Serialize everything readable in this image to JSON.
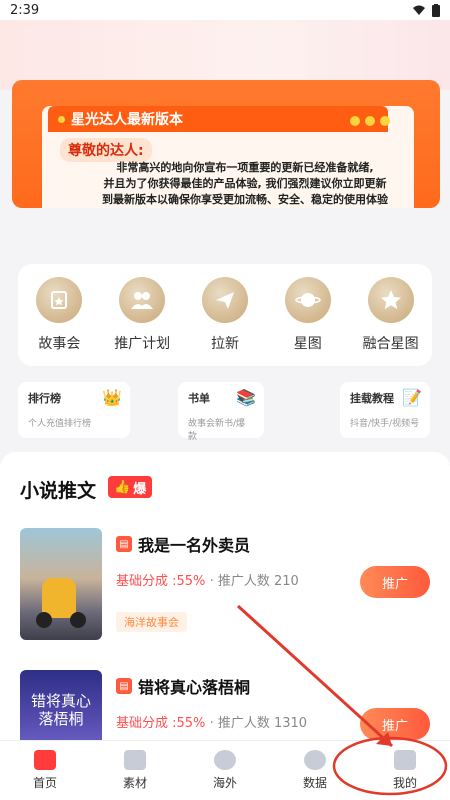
{
  "status_bar": {
    "time": "2:39"
  },
  "banner": {
    "tab_title": "星光达人最新版本",
    "greeting": "尊敬的达人:",
    "body_lines": [
      "非常高兴的地向你宣布一项重要的更新已经准备就绪,",
      "并且为了你获得最佳的产品体验, 我们强烈建议你立即更新",
      "到最新版本以确保你享受更加流畅、安全、稳定的使用体验"
    ]
  },
  "menu": {
    "items": [
      {
        "label": "故事会",
        "icon": "story-icon"
      },
      {
        "label": "推广计划",
        "icon": "users-icon"
      },
      {
        "label": "拉新",
        "icon": "paper-plane-icon"
      },
      {
        "label": "星图",
        "icon": "planet-icon"
      },
      {
        "label": "融合星图",
        "icon": "star-icon"
      }
    ]
  },
  "cards": [
    {
      "title": "排行榜",
      "subtitle": "个人充值排行榜",
      "icon": "crown-icon"
    },
    {
      "title": "书单",
      "subtitle": "故事会新书/爆款",
      "icon": "books-icon"
    },
    {
      "title": "挂载教程",
      "subtitle": "抖音/快手/视频号",
      "icon": "tutorial-icon"
    }
  ],
  "novels": {
    "section_title": "小说推文",
    "hot_label": "爆",
    "items": [
      {
        "title": "我是一名外卖员",
        "rate_label": "基础分成 :55%",
        "promoters": "· 推广人数 210",
        "tag": "海洋故事会",
        "button": "推广"
      },
      {
        "title": "错将真心落梧桐",
        "cover_text": "错将真心落梧桐",
        "rate_label": "基础分成 :55%",
        "promoters": "· 推广人数 1310",
        "button": "推广"
      }
    ]
  },
  "bottom_nav": {
    "items": [
      {
        "label": "首页",
        "icon": "home-icon",
        "active": true
      },
      {
        "label": "素材",
        "icon": "chart-icon"
      },
      {
        "label": "海外",
        "icon": "globe-icon"
      },
      {
        "label": "数据",
        "icon": "data-icon"
      },
      {
        "label": "我的",
        "icon": "profile-icon"
      }
    ]
  },
  "colors": {
    "accent": "#ff5a3c",
    "banner": "#ff6a1c",
    "annotation": "#e23a2a"
  }
}
